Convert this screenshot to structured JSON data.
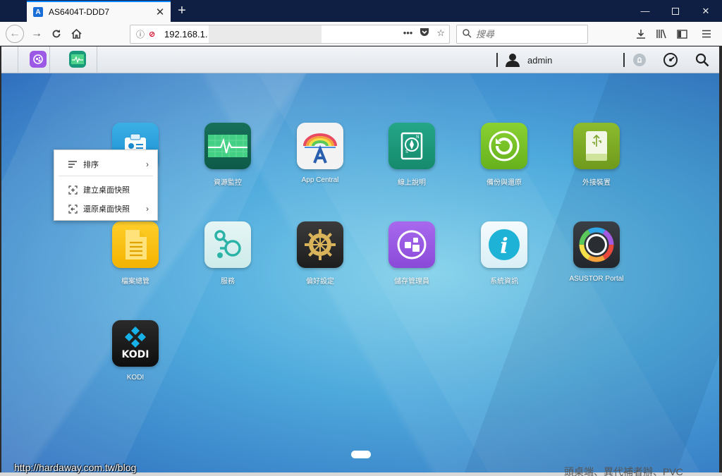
{
  "browser": {
    "tab_title": "AS6404T-DDD7",
    "url": "192.168.1.",
    "search_placeholder": "搜尋"
  },
  "adm": {
    "username": "admin"
  },
  "desktop": {
    "apps": [
      {
        "label": "資源監控"
      },
      {
        "label": "App Central"
      },
      {
        "label": "線上說明"
      },
      {
        "label": "備份與還原"
      },
      {
        "label": "外接裝置"
      },
      {
        "label": "檔案總管"
      },
      {
        "label": "服務"
      },
      {
        "label": "偏好設定"
      },
      {
        "label": "儲存管理員"
      },
      {
        "label": "系統資訊"
      },
      {
        "label": "ASUSTOR Portal"
      },
      {
        "label": "KODI"
      }
    ],
    "kodi_logo_text": "KODI"
  },
  "context_menu": {
    "items": [
      {
        "label": "排序"
      },
      {
        "label": "建立桌面快照"
      },
      {
        "label": "還原桌面快照"
      }
    ]
  },
  "watermark": "http://hardaway.com.tw/blog",
  "background_text": "頭桌端、異代補者辦、PVC"
}
